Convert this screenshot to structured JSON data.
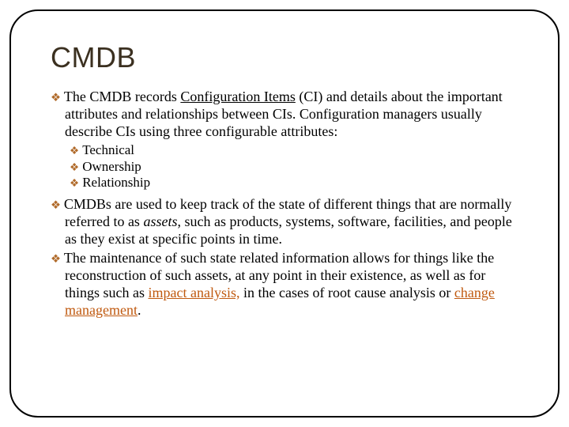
{
  "title": "CMDB",
  "bullets": {
    "b1_pre": "The CMDB records ",
    "b1_ci": "Configuration Items",
    "b1_post": " (CI) and details about the important attributes and relationships between CIs. Configuration managers usually describe CIs using three configurable attributes:",
    "sub1": "Technical",
    "sub2": "Ownership",
    "sub3": "Relationship",
    "b2_pre": "CMDBs are used to keep track of the state of different things that are normally referred to as ",
    "b2_assets": "assets",
    "b2_post": ", such as products, systems, software, facilities, and people as they exist at specific points in time.",
    "b3_pre": "The maintenance of such state related information allows for things like the reconstruction of such assets, at any point in their existence, as well as for things such as ",
    "b3_link1": "impact analysis,",
    "b3_mid": " in the cases of root cause analysis or ",
    "b3_link2": "change management",
    "b3_end": "."
  },
  "glyph": "❖"
}
